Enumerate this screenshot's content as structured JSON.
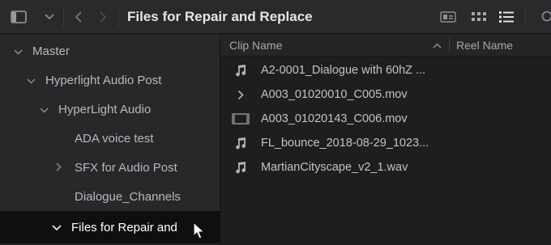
{
  "topbar": {
    "title": "Files for Repair and Replace",
    "icons": {
      "panel": "sidebar-panel-icon",
      "dropdown": "chevron-down-icon",
      "back": "chevron-left-icon",
      "forward": "chevron-right-icon",
      "filmstrip_view": "filmstrip-view-icon",
      "grid_view": "grid-view-icon",
      "list_view": "list-view-icon",
      "search": "search-icon"
    }
  },
  "sidebar": {
    "items": [
      {
        "label": "Master",
        "chevron": "⌄"
      },
      {
        "label": "Hyperlight Audio Post",
        "chevron": "⌄"
      },
      {
        "label": "HyperLight Audio",
        "chevron": "⌄"
      },
      {
        "label": "ADA voice test",
        "chevron": ""
      },
      {
        "label": "SFX for Audio Post",
        "chevron": "›"
      },
      {
        "label": "Dialogue_Channels",
        "chevron": ""
      },
      {
        "label": "Files for Repair and",
        "chevron": "⌄"
      }
    ]
  },
  "table": {
    "columns": {
      "clip_name": "Clip Name",
      "reel_name": "Reel Name"
    },
    "sort_indicator": "^",
    "rows": [
      {
        "name": "A2-0001_Dialogue with 60hZ ...",
        "icon": "audio-note-icon"
      },
      {
        "name": "A003_01020010_C005.mov",
        "icon": "chevron-right-icon"
      },
      {
        "name": "A003_01020143_C006.mov",
        "icon": "film-clip-icon"
      },
      {
        "name": "FL_bounce_2018-08-29_1023...",
        "icon": "audio-note-icon"
      },
      {
        "name": "MartianCityscape_v2_1.wav",
        "icon": "audio-note-icon"
      }
    ]
  },
  "colors": {
    "background": "#1e1e20",
    "sidebar": "#28282b",
    "selected": "#0f0f10",
    "text": "#c9c9cc"
  }
}
